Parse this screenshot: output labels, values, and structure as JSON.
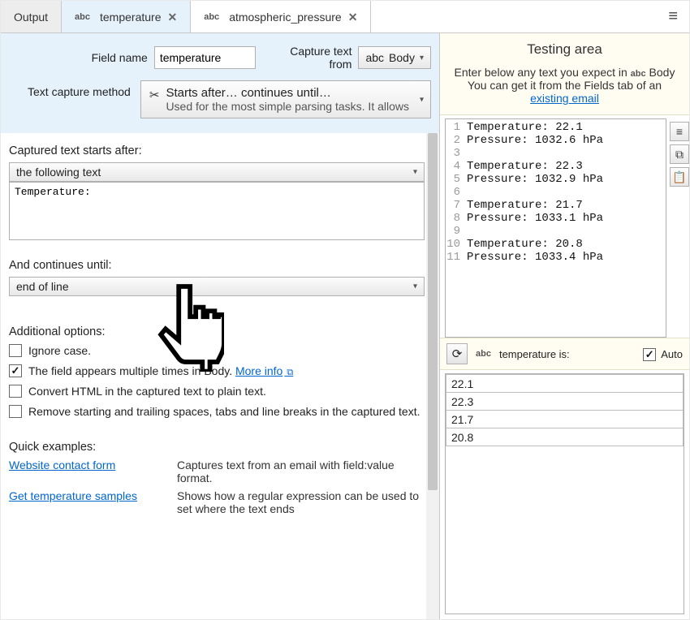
{
  "tabs": {
    "output": "Output",
    "temperature": "temperature",
    "pressure": "atmospheric_pressure"
  },
  "header": {
    "fieldname_label": "Field name",
    "fieldname_value": "temperature",
    "capturefrom_label": "Capture text from",
    "capturefrom_value": "Body",
    "method_label": "Text capture method",
    "method_line1": "Starts after… continues until…",
    "method_line2": "Used for the most simple parsing tasks. It allows"
  },
  "starts": {
    "title": "Captured text starts after:",
    "select": "the following text",
    "value": "Temperature:"
  },
  "until": {
    "title": "And continues until:",
    "select": "end of line"
  },
  "options": {
    "title": "Additional options:",
    "ignore_case": "Ignore case.",
    "multiple": "The field appears multiple times in Body.",
    "more_info": "More info",
    "convert_html": "Convert HTML in the captured text to plain text.",
    "trim": "Remove starting and trailing spaces, tabs and line breaks in the captured text."
  },
  "examples": {
    "title": "Quick examples:",
    "rows": [
      {
        "link": "Website contact form",
        "desc": "Captures text from an email with field:value format."
      },
      {
        "link": "Get temperature samples",
        "desc": "Shows how a regular expression can be used to set where the text ends"
      }
    ]
  },
  "testing": {
    "title": "Testing area",
    "line1a": "Enter below any text you expect in",
    "line1b": "Body",
    "line2a": "You can get it from the Fields tab of an",
    "line2b": "existing email",
    "code": [
      "Temperature: 22.1",
      "Pressure: 1032.6 hPa",
      "",
      "Temperature: 22.3",
      "Pressure: 1032.9 hPa",
      "",
      "Temperature: 21.7",
      "Pressure: 1033.1 hPa",
      "",
      "Temperature: 20.8",
      "Pressure: 1033.4 hPa"
    ],
    "result_label": "temperature is:",
    "auto_label": "Auto",
    "results": [
      "22.1",
      "22.3",
      "21.7",
      "20.8"
    ]
  },
  "abc": "abc"
}
